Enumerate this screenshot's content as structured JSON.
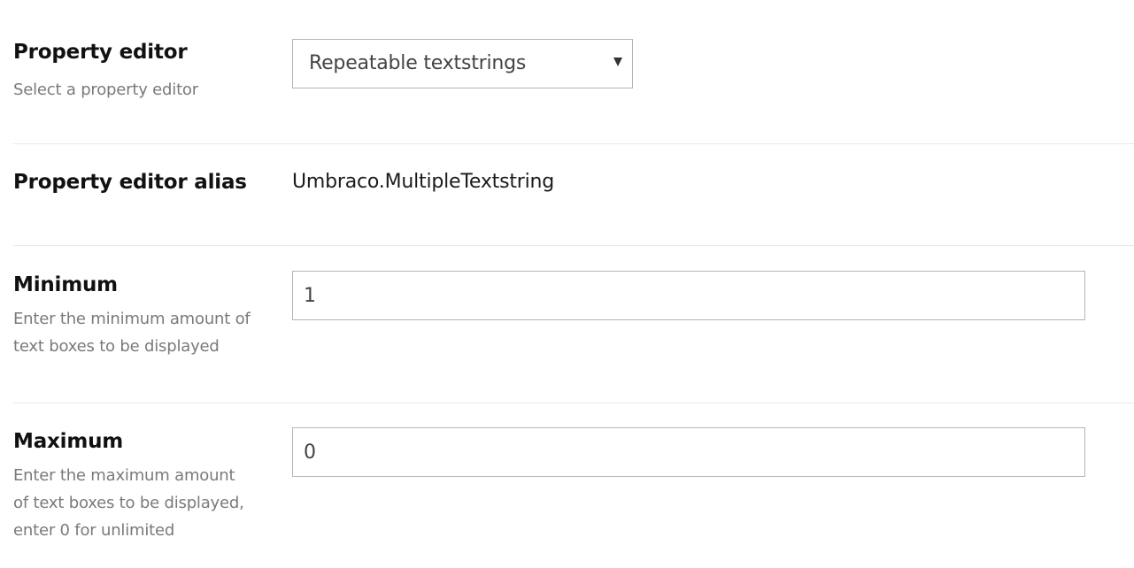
{
  "property_editor": {
    "title": "Property editor",
    "description": "Select a property editor",
    "selected": "Repeatable textstrings"
  },
  "property_editor_alias": {
    "title": "Property editor alias",
    "value": "Umbraco.MultipleTextstring"
  },
  "minimum": {
    "title": "Minimum",
    "description_line1": "Enter the minimum amount of",
    "description_line2": "text boxes to be displayed",
    "value": "1"
  },
  "maximum": {
    "title": "Maximum",
    "description_line1": "Enter the maximum amount",
    "description_line2": "of text boxes to be displayed,",
    "description_line3": "enter 0 for unlimited",
    "value": "0"
  },
  "icons": {
    "select_arrow": "caret-down-icon"
  },
  "colors": {
    "label": "#111111",
    "description": "#7a7a7a",
    "border": "#b5b5b5",
    "divider": "#e9e9eb"
  }
}
